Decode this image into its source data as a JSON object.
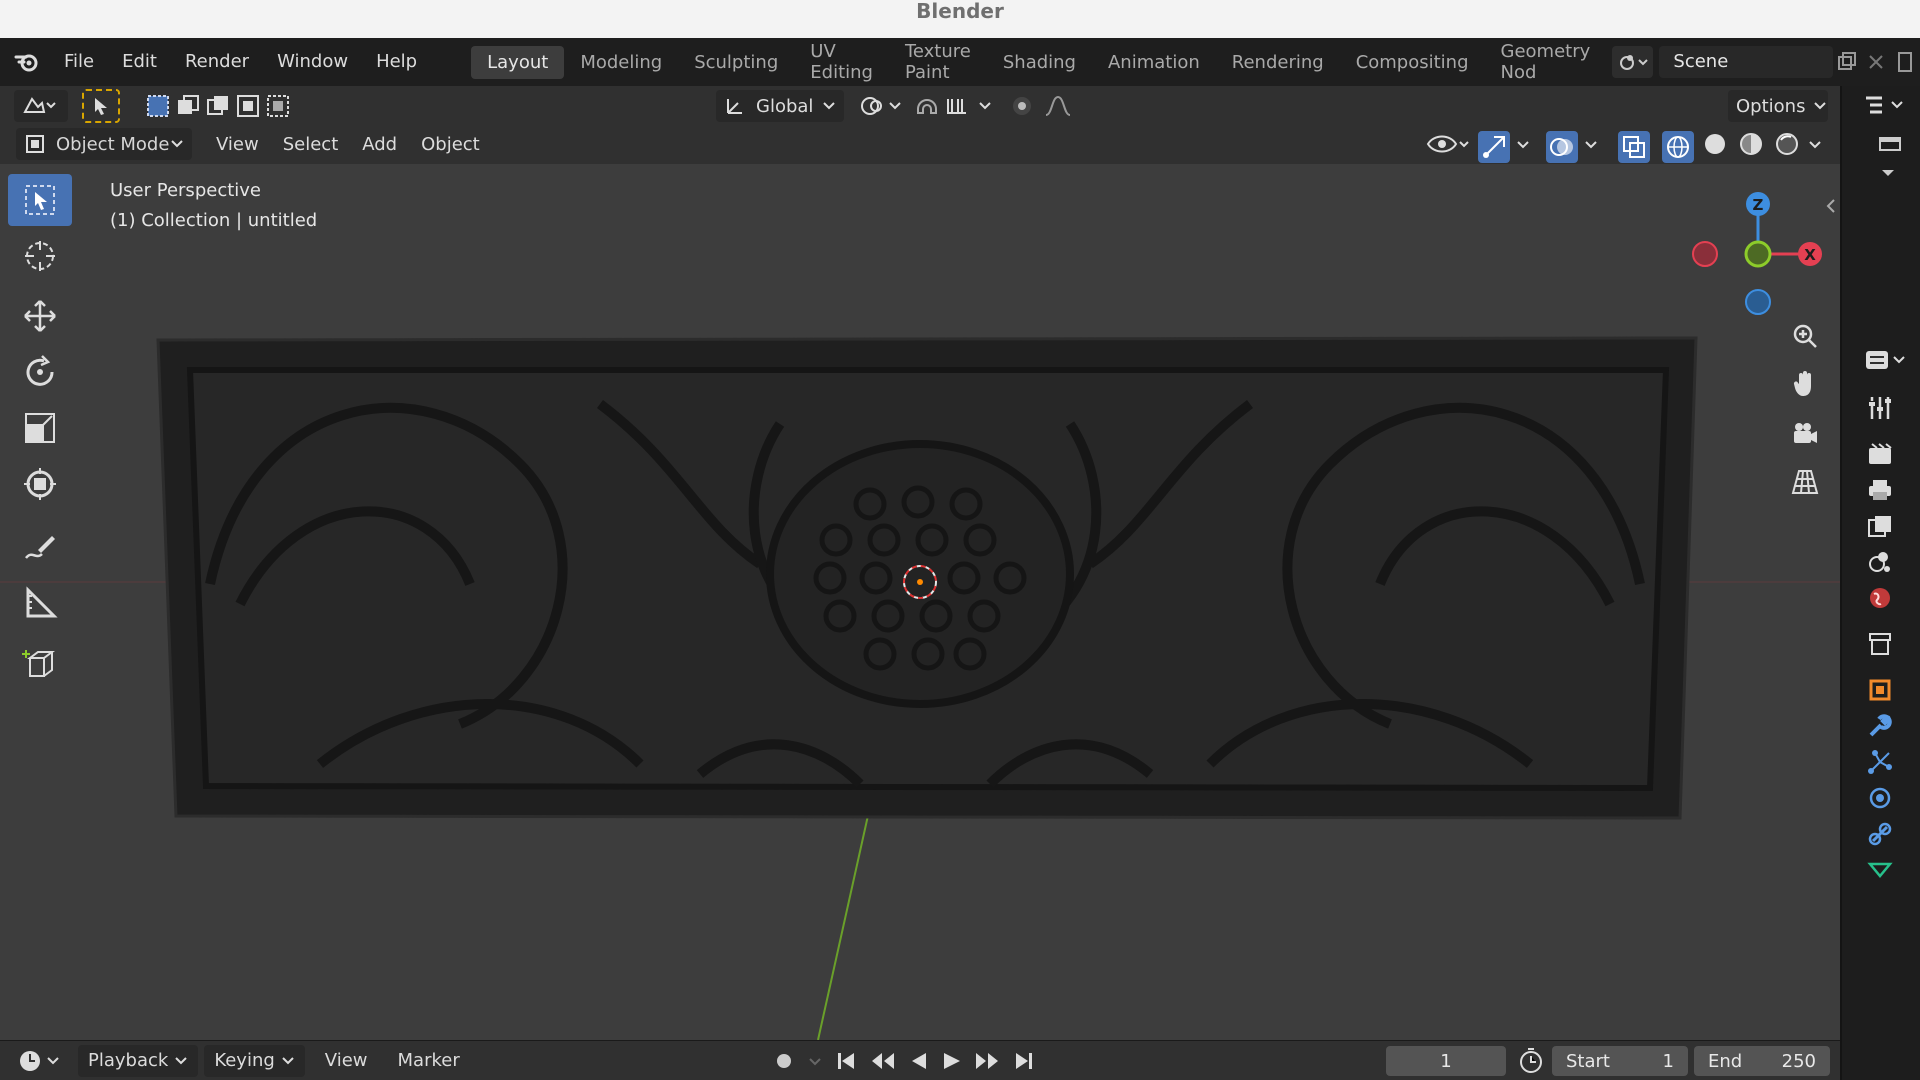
{
  "window": {
    "title": "Blender"
  },
  "menu": [
    "File",
    "Edit",
    "Render",
    "Window",
    "Help"
  ],
  "workspaces": [
    {
      "label": "Layout",
      "active": true
    },
    {
      "label": "Modeling"
    },
    {
      "label": "Sculpting"
    },
    {
      "label": "UV Editing"
    },
    {
      "label": "Texture Paint"
    },
    {
      "label": "Shading"
    },
    {
      "label": "Animation"
    },
    {
      "label": "Rendering"
    },
    {
      "label": "Compositing"
    },
    {
      "label": "Geometry Nod"
    }
  ],
  "scene": {
    "name": "Scene"
  },
  "tool_header": {
    "orientation": "Global",
    "options_label": "Options"
  },
  "viewport_header": {
    "mode": "Object Mode",
    "menus": [
      "View",
      "Select",
      "Add",
      "Object"
    ]
  },
  "viewport": {
    "perspective_label": "User Perspective",
    "collection_label": "(1) Collection | untitled",
    "gizmo": {
      "z": "Z",
      "x": "X"
    }
  },
  "timeline": {
    "menus": [
      "Playback",
      "Keying",
      "View",
      "Marker"
    ],
    "current_frame": "1",
    "start_label": "Start",
    "start_value": "1",
    "end_label": "End",
    "end_value": "250"
  },
  "colors": {
    "accent": "#4772b3",
    "axis_x": "#e44052",
    "axis_y": "#8dcc2a",
    "axis_z": "#3d8ee0",
    "object_origin": "#ff8a00"
  }
}
